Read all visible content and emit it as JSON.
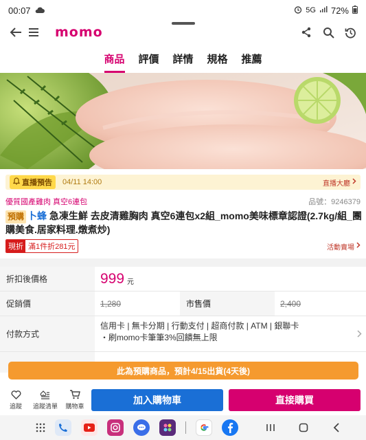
{
  "status_bar": {
    "time": "00:07",
    "network": "5G",
    "battery": "72%"
  },
  "header": {
    "logo": "momo"
  },
  "tabs": [
    {
      "label": "商品",
      "active": true
    },
    {
      "label": "評價",
      "active": false
    },
    {
      "label": "詳情",
      "active": false
    },
    {
      "label": "規格",
      "active": false
    },
    {
      "label": "推薦",
      "active": false
    }
  ],
  "live_banner": {
    "badge": "直播預告",
    "date": "04/11 14:00",
    "link": "直播大廳"
  },
  "product": {
    "tagline": "優質國產雞肉 真空6連包",
    "code": "品號：9246379",
    "preorder_badge": "預購",
    "brand": "卜蜂",
    "title": " 急凍生鮮 去皮清雞胸肉 真空6連包x2組_momo美味標章認證(2.7kg/組_團購美食.居家料理.燉煮炒)"
  },
  "promo": {
    "tag_type": "現折",
    "tag_text": "滿1件折281元",
    "activity_link": "活動賣場"
  },
  "price_table": {
    "discount_label": "折扣後價格",
    "discount_price": "999",
    "currency": "元",
    "promo_label": "促銷價",
    "promo_price": "1,280",
    "market_label": "市售價",
    "market_price": "2,400",
    "payment_label": "付款方式",
    "payment_line1": "信用卡 | 無卡分期 | 行動支付 | 超商付款 | ATM | 銀聯卡",
    "payment_line2": "・刷momo卡筆筆3%回饋無上限"
  },
  "ship_notice": "此為預購商品，預計4/15出貨(4天後)",
  "bottom_bar": {
    "track_label": "追蹤",
    "track_list_label": "追蹤清單",
    "cart_label": "購物車",
    "add_cart_button": "加入購物車",
    "buy_now_button": "直接購買"
  },
  "colors": {
    "brand": "#d6006f",
    "blue": "#1a6fd6",
    "orange": "#f59a2f"
  },
  "dock_apps": [
    "phone-icon",
    "youtube-icon",
    "instagram-icon",
    "messages-icon",
    "puzzle-app-icon",
    "google-icon",
    "facebook-icon"
  ]
}
